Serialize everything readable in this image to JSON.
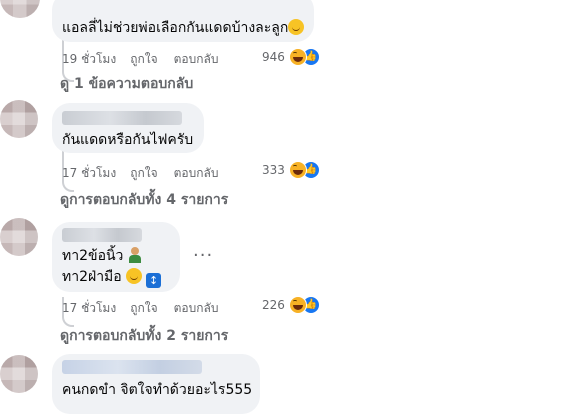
{
  "comments": [
    {
      "text": "แอลลี่ไม่ช่วยพ่อเลือกกันแดดบ้างละลูก",
      "emoji_icon": "astonished-face-icon",
      "time": "19 ชั่วโมง",
      "like_label": "ถูกใจ",
      "reply_label": "ตอบกลับ",
      "reaction_count": "946",
      "replies_link": "ดู 1 ข้อความตอบกลับ"
    },
    {
      "text": "กันแดดหรือกันไฟครับ",
      "time": "17 ชั่วโมง",
      "like_label": "ถูกใจ",
      "reply_label": "ตอบกลับ",
      "reaction_count": "333",
      "replies_link": "ดูการตอบกลับทั้ง 4 รายการ"
    },
    {
      "line1": "ทา2ข้อนิ้ว",
      "line2": "ทา2ฝ่ามือ",
      "more_label": "···",
      "time": "17 ชั่วโมง",
      "like_label": "ถูกใจ",
      "reply_label": "ตอบกลับ",
      "reaction_count": "226",
      "replies_link": "ดูการตอบกลับทั้ง 2 รายการ"
    },
    {
      "text": "คนกดขำ จิตใจทำด้วยอะไร555"
    }
  ],
  "colors": {
    "bubble": "#f0f2f5",
    "meta": "#65676b",
    "haha": "#f7b125",
    "like": "#1877f2"
  }
}
